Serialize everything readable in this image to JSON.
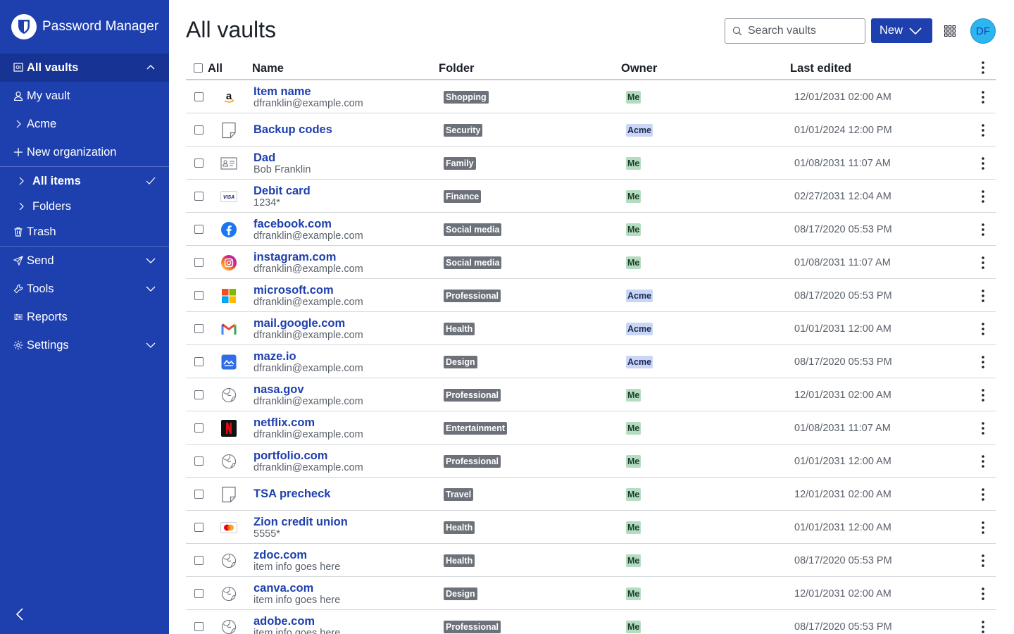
{
  "app": {
    "name": "Password Manager"
  },
  "sidebar": {
    "items": [
      {
        "label": "All vaults"
      },
      {
        "label": "My vault"
      },
      {
        "label": "Acme"
      },
      {
        "label": "New organization"
      },
      {
        "label": "All items"
      },
      {
        "label": "Folders"
      },
      {
        "label": "Trash"
      },
      {
        "label": "Send"
      },
      {
        "label": "Tools"
      },
      {
        "label": "Reports"
      },
      {
        "label": "Settings"
      }
    ]
  },
  "header": {
    "title": "All vaults",
    "search_placeholder": "Search vaults",
    "new_label": "New",
    "avatar_initials": "DF"
  },
  "table": {
    "columns": {
      "all": "All",
      "name": "Name",
      "folder": "Folder",
      "owner": "Owner",
      "edited": "Last edited"
    },
    "rows": [
      {
        "icon": "amazon-icon",
        "name": "Item name",
        "sub": "dfranklin@example.com",
        "folder": "Shopping",
        "owner": "Me",
        "edited": "12/01/2031 02:00 AM"
      },
      {
        "icon": "note-icon",
        "name": "Backup codes",
        "sub": "",
        "folder": "Security",
        "owner": "Acme",
        "edited": "01/01/2024 12:00 PM"
      },
      {
        "icon": "id-card-icon",
        "name": "Dad",
        "sub": "Bob Franklin",
        "folder": "Family",
        "owner": "Me",
        "edited": "01/08/2031 11:07 AM"
      },
      {
        "icon": "visa-card-icon",
        "name": "Debit card",
        "sub": "1234*",
        "folder": "Finance",
        "owner": "Me",
        "edited": "02/27/2031 12:04 AM"
      },
      {
        "icon": "facebook-icon",
        "name": "facebook.com",
        "sub": "dfranklin@example.com",
        "folder": "Social media",
        "owner": "Me",
        "edited": "08/17/2020 05:53 PM"
      },
      {
        "icon": "instagram-icon",
        "name": "instagram.com",
        "sub": "dfranklin@example.com",
        "folder": "Social media",
        "owner": "Me",
        "edited": "01/08/2031 11:07 AM"
      },
      {
        "icon": "microsoft-icon",
        "name": "microsoft.com",
        "sub": "dfranklin@example.com",
        "folder": "Professional",
        "owner": "Acme",
        "edited": "08/17/2020 05:53 PM"
      },
      {
        "icon": "gmail-icon",
        "name": "mail.google.com",
        "sub": "dfranklin@example.com",
        "folder": "Health",
        "owner": "Acme",
        "edited": "01/01/2031 12:00 AM"
      },
      {
        "icon": "maze-icon",
        "name": "maze.io",
        "sub": "dfranklin@example.com",
        "folder": "Design",
        "owner": "Acme",
        "edited": "08/17/2020 05:53 PM"
      },
      {
        "icon": "globe-icon",
        "name": "nasa.gov",
        "sub": "dfranklin@example.com",
        "folder": "Professional",
        "owner": "Me",
        "edited": "12/01/2031 02:00 AM"
      },
      {
        "icon": "netflix-icon",
        "name": "netflix.com",
        "sub": "dfranklin@example.com",
        "folder": "Entertainment",
        "owner": "Me",
        "edited": "01/08/2031 11:07 AM"
      },
      {
        "icon": "globe-icon",
        "name": "portfolio.com",
        "sub": "dfranklin@example.com",
        "folder": "Professional",
        "owner": "Me",
        "edited": "01/01/2031 12:00 AM"
      },
      {
        "icon": "note-icon",
        "name": "TSA precheck",
        "sub": "",
        "folder": "Travel",
        "owner": "Me",
        "edited": "12/01/2031 02:00 AM"
      },
      {
        "icon": "mastercard-icon",
        "name": "Zion credit union",
        "sub": "5555*",
        "folder": "Health",
        "owner": "Me",
        "edited": "01/01/2031 12:00 AM"
      },
      {
        "icon": "globe-icon",
        "name": "zdoc.com",
        "sub": "item info goes here",
        "folder": "Health",
        "owner": "Me",
        "edited": "08/17/2020 05:53 PM"
      },
      {
        "icon": "globe-icon",
        "name": "canva.com",
        "sub": "item info goes here",
        "folder": "Design",
        "owner": "Me",
        "edited": "12/01/2031 02:00 AM"
      },
      {
        "icon": "globe-icon",
        "name": "adobe.com",
        "sub": "item info goes here",
        "folder": "Professional",
        "owner": "Me",
        "edited": "08/17/2020 05:53 PM"
      }
    ]
  },
  "colors": {
    "brand": "#1e3fae",
    "brand_dark": "#173494",
    "badge_me": "#b3dcc0",
    "badge_acme": "#c9d6f5",
    "folder_badge": "#6c717a",
    "avatar": "#2cb6f0"
  }
}
